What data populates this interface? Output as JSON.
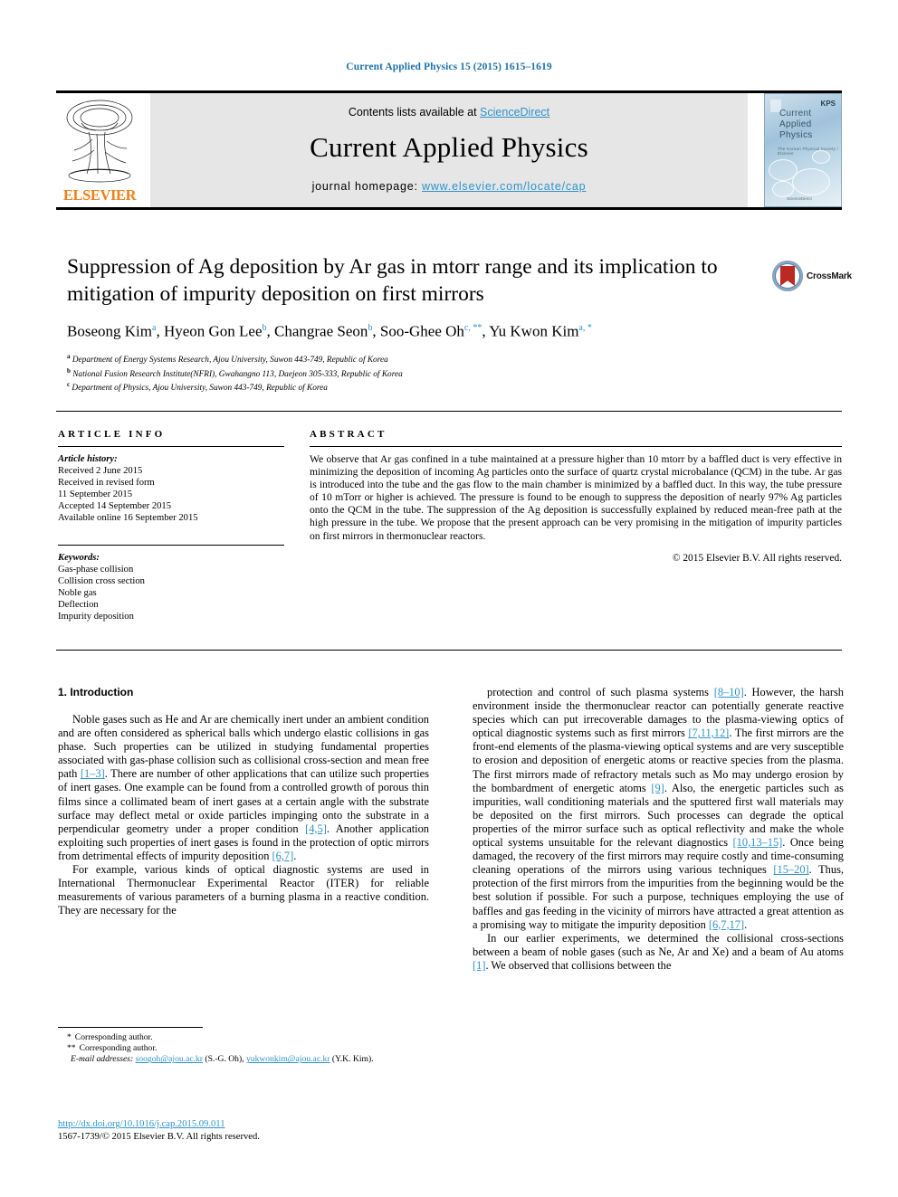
{
  "running_head": "Current Applied Physics 15 (2015) 1615–1619",
  "masthead": {
    "contents_prefix": "Contents lists available at ",
    "sciencedirect": "ScienceDirect",
    "journal_title": "Current Applied Physics",
    "homepage_prefix": "journal homepage: ",
    "homepage_url": "www.elsevier.com/locate/cap",
    "publisher": "ELSEVIER",
    "cover": {
      "line1": "Current",
      "line2": "Applied",
      "line3": "Physics",
      "society": "KPS",
      "subtitle": "The Korean Physical Society / Elsevier",
      "footer": "ScienceDirect"
    }
  },
  "crossmark": {
    "label": "CrossMark"
  },
  "article": {
    "title": "Suppression of Ag deposition by Ar gas in mtorr range and its implication to mitigation of impurity deposition on first mirrors",
    "authors": [
      {
        "name": "Boseong Kim",
        "marks": "a"
      },
      {
        "name": "Hyeon Gon Lee",
        "marks": "b"
      },
      {
        "name": "Changrae Seon",
        "marks": "b"
      },
      {
        "name": "Soo-Ghee Oh",
        "marks": "c, **"
      },
      {
        "name": "Yu Kwon Kim",
        "marks": "a, *"
      }
    ],
    "affiliations": [
      {
        "mark": "a",
        "text": "Department of Energy Systems Research, Ajou University, Suwon 443-749, Republic of Korea"
      },
      {
        "mark": "b",
        "text": "National Fusion Research Institute(NFRI), Gwahangno 113, Daejeon 305-333, Republic of Korea"
      },
      {
        "mark": "c",
        "text": "Department of Physics, Ajou University, Suwon 443-749, Republic of Korea"
      }
    ]
  },
  "article_info": {
    "heading": "ARTICLE INFO",
    "history_label": "Article history:",
    "history": [
      "Received 2 June 2015",
      "Received in revised form",
      "11 September 2015",
      "Accepted 14 September 2015",
      "Available online 16 September 2015"
    ],
    "keywords_label": "Keywords:",
    "keywords": [
      "Gas-phase collision",
      "Collision cross section",
      "Noble gas",
      "Deflection",
      "Impurity deposition"
    ]
  },
  "abstract": {
    "heading": "ABSTRACT",
    "text": "We observe that Ar gas confined in a tube maintained at a pressure higher than 10 mtorr by a baffled duct is very effective in minimizing the deposition of incoming Ag particles onto the surface of quartz crystal microbalance (QCM) in the tube. Ar gas is introduced into the tube and the gas flow to the main chamber is minimized by a baffled duct. In this way, the tube pressure of 10 mTorr or higher is achieved. The pressure is found to be enough to suppress the deposition of nearly 97% Ag particles onto the QCM in the tube. The suppression of the Ag deposition is successfully explained by reduced mean-free path at the high pressure in the tube. We propose that the present approach can be very promising in the mitigation of impurity particles on first mirrors in thermonuclear reactors.",
    "copyright": "© 2015 Elsevier B.V. All rights reserved."
  },
  "body": {
    "section_number_title": "1. Introduction",
    "left_paragraphs": [
      {
        "segments": [
          {
            "t": "Noble gases such as He and Ar are chemically inert under an ambient condition and are often considered as spherical balls which undergo elastic collisions in gas phase. Such properties can be utilized in studying fundamental properties associated with gas-phase collision such as collisional cross-section and mean free path "
          },
          {
            "t": "[1–3]",
            "ref": true
          },
          {
            "t": ". There are number of other applications that can utilize such properties of inert gases. One example can be found from a controlled growth of porous thin films since a collimated beam of inert gases at a certain angle with the substrate surface may deflect metal or oxide particles impinging onto the substrate in a perpendicular geometry under a proper condition "
          },
          {
            "t": "[4,5]",
            "ref": true
          },
          {
            "t": ". Another application exploiting such properties of inert gases is found in the protection of optic mirrors from detrimental effects of impurity deposition "
          },
          {
            "t": "[6,7]",
            "ref": true
          },
          {
            "t": "."
          }
        ]
      },
      {
        "segments": [
          {
            "t": "For example, various kinds of optical diagnostic systems are used in International Thermonuclear Experimental Reactor (ITER) for reliable measurements of various parameters of a burning plasma in a reactive condition. They are necessary for the"
          }
        ]
      }
    ],
    "right_paragraphs": [
      {
        "segments": [
          {
            "t": "protection and control of such plasma systems "
          },
          {
            "t": "[8–10]",
            "ref": true
          },
          {
            "t": ". However, the harsh environment inside the thermonuclear reactor can potentially generate reactive species which can put irrecoverable damages to the plasma-viewing optics of optical diagnostic systems such as first mirrors "
          },
          {
            "t": "[7,11,12]",
            "ref": true
          },
          {
            "t": ". The first mirrors are the front-end elements of the plasma-viewing optical systems and are very susceptible to erosion and deposition of energetic atoms or reactive species from the plasma. The first mirrors made of refractory metals such as Mo may undergo erosion by the bombardment of energetic atoms "
          },
          {
            "t": "[9]",
            "ref": true
          },
          {
            "t": ". Also, the energetic particles such as impurities, wall conditioning materials and the sputtered first wall materials may be deposited on the first mirrors. Such processes can degrade the optical properties of the mirror surface such as optical reflectivity and make the whole optical systems unsuitable for the relevant diagnostics "
          },
          {
            "t": "[10,13–15]",
            "ref": true
          },
          {
            "t": ". Once being damaged, the recovery of the first mirrors may require costly and time-consuming cleaning operations of the mirrors using various techniques "
          },
          {
            "t": "[15–20]",
            "ref": true
          },
          {
            "t": ". Thus, protection of the first mirrors from the impurities from the beginning would be the best solution if possible. For such a purpose, techniques employing the use of baffles and gas feeding in the vicinity of mirrors have attracted a great attention as a promising way to mitigate the impurity deposition "
          },
          {
            "t": "[6,7,17]",
            "ref": true
          },
          {
            "t": "."
          }
        ]
      },
      {
        "segments": [
          {
            "t": "In our earlier experiments, we determined the collisional cross-sections between a beam of noble gases (such as Ne, Ar and Xe) and a beam of Au atoms "
          },
          {
            "t": "[1]",
            "ref": true
          },
          {
            "t": ". We observed that collisions between the"
          }
        ]
      }
    ]
  },
  "footnotes": {
    "corr1_mark": "*",
    "corr1": "Corresponding author.",
    "corr2_mark": "**",
    "corr2": "Corresponding author.",
    "email_label": "E-mail addresses:",
    "email1": "soogoh@ajou.ac.kr",
    "email1_owner": "(S.-G. Oh)",
    "email2": "yukwonkim@ajou.ac.kr",
    "email2_owner": "(Y.K. Kim)."
  },
  "doi_block": {
    "doi": "http://dx.doi.org/10.1016/j.cap.2015.09.011",
    "issn": "1567-1739/© 2015 Elsevier B.V. All rights reserved."
  },
  "colors": {
    "link_blue": "#2e93c9",
    "elsevier_orange": "#f07f1a",
    "band_grey": "#e6e6e6"
  }
}
